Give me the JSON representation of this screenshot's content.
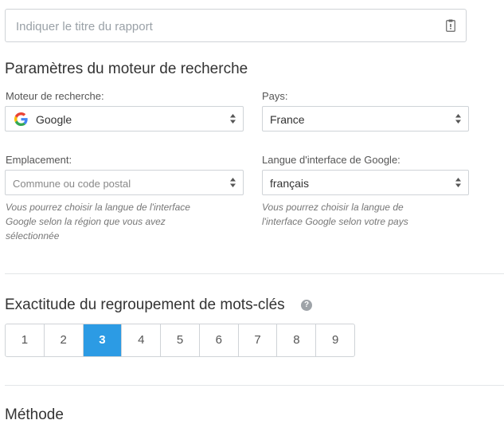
{
  "report_title": {
    "placeholder": "Indiquer le titre du rapport"
  },
  "engine_section": {
    "title": "Paramètres du moteur de recherche",
    "search_engine": {
      "label": "Moteur de recherche:",
      "value": "Google",
      "icon": "google-g-icon"
    },
    "country": {
      "label": "Pays:",
      "value": "France"
    },
    "location": {
      "label": "Emplacement:",
      "placeholder": "Commune ou code postal",
      "hint_line1": "Vous pourrez choisir la langue de l'interface",
      "hint_line2": "Google selon la région que vous avez",
      "hint_line3": "sélectionnée"
    },
    "interface_language": {
      "label": "Langue d'interface de Google:",
      "value": "français",
      "hint_line1": "Vous pourrez choisir la langue de",
      "hint_line2": "l'interface Google selon votre pays"
    }
  },
  "accuracy_section": {
    "title": "Exactitude du regroupement de mots-clés",
    "help_glyph": "?",
    "options": [
      "1",
      "2",
      "3",
      "4",
      "5",
      "6",
      "7",
      "8",
      "9"
    ],
    "selected": "3"
  },
  "method_section": {
    "title": "Méthode"
  },
  "colors": {
    "accent": "#2c9be4",
    "border": "#cfd3d7",
    "divider": "#e3e6e8"
  }
}
